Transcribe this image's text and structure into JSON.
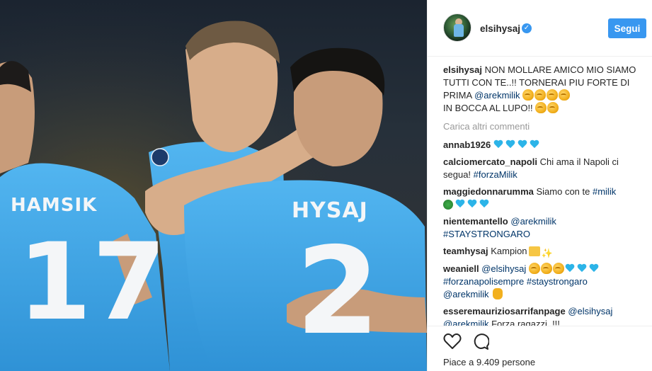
{
  "photo": {
    "jersey_left_name": "HAMSIK",
    "jersey_left_number": "17",
    "jersey_right_name": "HYSAJ",
    "jersey_right_number": "2"
  },
  "header": {
    "username": "elsihysaj",
    "verified_icon": "verified-badge-icon",
    "follow_label": "Segui",
    "accent": "#3897f0"
  },
  "caption": {
    "user": "elsihysaj",
    "text_1": "NON MOLLARE AMICO MIO SIAMO TUTTI CON TE..!! TORNERAI PIU FORTE DI PRIMA ",
    "mention": "@arekmilik",
    "text_2": "IN BOCCA AL LUPO!!"
  },
  "load_more": "Carica altri commenti",
  "comments": [
    {
      "user": "annab1926"
    },
    {
      "user": "calciomercato_napoli",
      "text": "Chi ama il Napoli ci segua! ",
      "tag": "#forzaMilik"
    },
    {
      "user": "maggiedonnarumma",
      "text": "Siamo con te ",
      "tag": "#milik"
    },
    {
      "user": "nientemantello",
      "mention": "@arekmilik",
      "tag": "#STAYSTRONGARO"
    },
    {
      "user": "teamhysaj",
      "text": "Kampion"
    },
    {
      "user": "weaniell",
      "mention": "@elsihysaj",
      "tag1": "#forzanapolisempre",
      "tag2": "#staystrongaro",
      "mention2": "@arekmilik"
    },
    {
      "user": "esseremauriziosarrifanpage",
      "mention": "@elsihysaj",
      "mention2": "@arekmilik",
      "text": " Forza ragazzi..!!!"
    }
  ],
  "actions": {
    "like_icon": "heart-outline-icon",
    "comment_icon": "comment-bubble-icon",
    "likes_text": "Piace a 9.409 persone"
  }
}
